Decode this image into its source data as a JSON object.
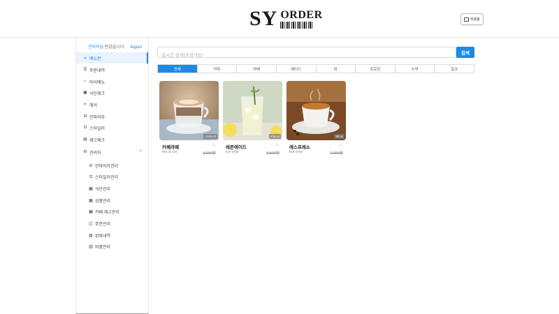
{
  "header": {
    "logo_main": "SY",
    "logo_sub": "ORDER",
    "staff_button": "비용충"
  },
  "sidebar": {
    "greeting_name": "관리자",
    "greeting_text": "님 반갑습니다.",
    "logout": "logout",
    "items": [
      {
        "label": "메뉴판",
        "icon": "☕",
        "name": "menu"
      },
      {
        "label": "주문내역",
        "icon": "☰",
        "name": "order-history"
      },
      {
        "label": "마이메뉴",
        "icon": "☆",
        "name": "my-menu"
      },
      {
        "label": "식단체크",
        "icon": "▣",
        "name": "diet-check"
      },
      {
        "label": "헤어",
        "icon": "✂",
        "name": "hair"
      },
      {
        "label": "안마의자",
        "icon": "⊟",
        "name": "massage-chair"
      },
      {
        "label": "스타일러",
        "icon": "⊡",
        "name": "styler"
      },
      {
        "label": "재고체크",
        "icon": "▤",
        "name": "stock-check"
      },
      {
        "label": "관리자",
        "icon": "⚙",
        "name": "admin"
      }
    ],
    "sub_items": [
      {
        "label": "안마의자관리",
        "icon": "⊟",
        "name": "massage-chair-admin"
      },
      {
        "label": "스타일러관리",
        "icon": "⊡",
        "name": "styler-admin"
      },
      {
        "label": "식단관리",
        "icon": "▦",
        "name": "diet-admin"
      },
      {
        "label": "상품관리",
        "icon": "▦",
        "name": "product-admin"
      },
      {
        "label": "카페 재고관리",
        "icon": "▦",
        "name": "cafe-stock-admin"
      },
      {
        "label": "주문관리",
        "icon": "◫",
        "name": "order-admin"
      },
      {
        "label": "완료내역",
        "icon": "▨",
        "name": "completed"
      },
      {
        "label": "비품관리",
        "icon": "▥",
        "name": "supplies-admin"
      }
    ]
  },
  "search": {
    "placeholder": "실시간 검색(초성가능)",
    "button": "검색"
  },
  "tabs": [
    "전체",
    "커피",
    "라떼",
    "에이드",
    "차",
    "프로틴",
    "스낵",
    "밀크"
  ],
  "products": [
    {
      "title": "카페라떼",
      "sub": "hot & ice",
      "price": "3,000원",
      "kcal": "150kcal"
    },
    {
      "title": "레몬에이드",
      "sub": "ice only",
      "price": "3,500원",
      "kcal": "40kcal"
    },
    {
      "title": "에스프레소",
      "sub": "hot only",
      "price": "2,000원",
      "kcal": "5kcal"
    }
  ],
  "colors": {
    "accent": "#1e88e5"
  }
}
